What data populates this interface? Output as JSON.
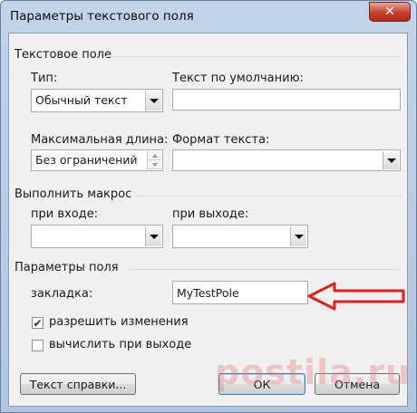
{
  "window": {
    "title": "Параметры текстового поля",
    "close_glyph": "✕"
  },
  "text_field_group": {
    "title": "Текстовое поле",
    "type_label": "Тип:",
    "type_value": "Обычный текст",
    "default_text_label": "Текст по умолчанию:",
    "default_text_value": "",
    "max_length_label": "Максимальная длина:",
    "max_length_value": "Без ограничений",
    "format_label": "Формат текста:",
    "format_value": ""
  },
  "macro_group": {
    "title": "Выполнить макрос",
    "on_entry_label": "при входе:",
    "on_entry_value": "",
    "on_exit_label": "при выходе:",
    "on_exit_value": ""
  },
  "field_options_group": {
    "title": "Параметры поля",
    "bookmark_label": "закладка:",
    "bookmark_value": "MyTestPole",
    "allow_changes_label": "разрешить изменения",
    "allow_changes_checked": true,
    "calc_on_exit_label": "вычислить при выходе",
    "calc_on_exit_checked": false
  },
  "buttons": {
    "help_text": "Текст справки...",
    "ok": "ОК",
    "cancel": "Отмена"
  },
  "annotation": {
    "color": "#e0201a"
  },
  "watermark": {
    "text": "postila.ru"
  }
}
